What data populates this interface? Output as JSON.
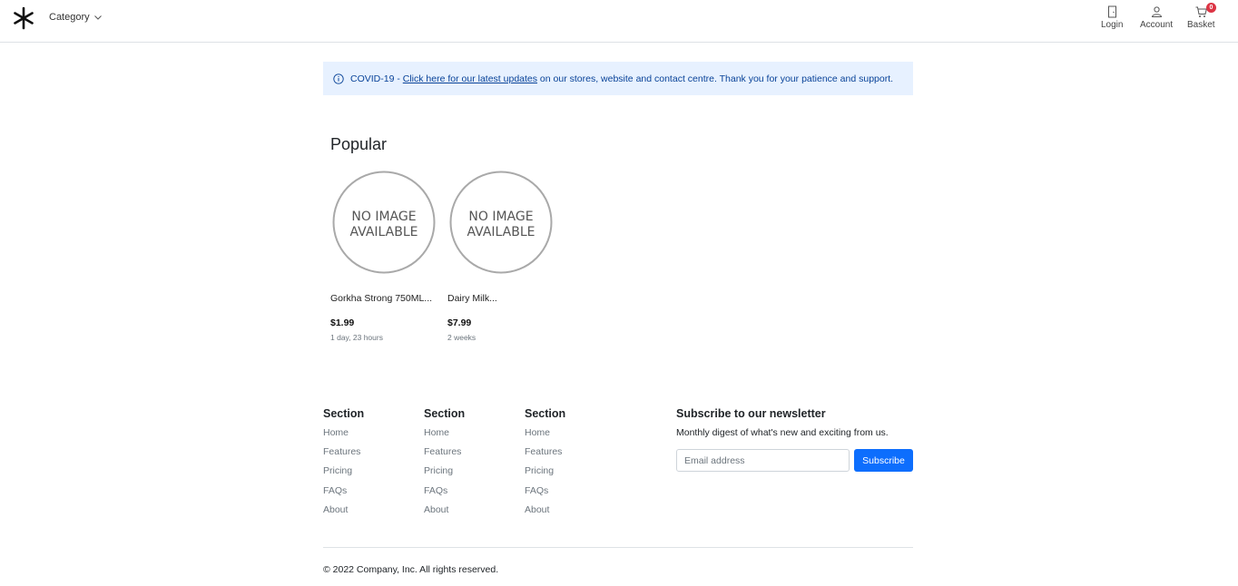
{
  "header": {
    "category_label": "Category",
    "nav": {
      "login_label": "Login",
      "account_label": "Account",
      "basket_label": "Basket",
      "basket_count": "0"
    }
  },
  "alert": {
    "prefix": "COVID-19 - ",
    "link_text": "Click here for our latest updates",
    "suffix": " on our stores, website and contact centre. Thank you for your patience and support."
  },
  "popular": {
    "title": "Popular",
    "products": [
      {
        "image_text_1": "NO IMAGE",
        "image_text_2": "AVAILABLE",
        "name": "Gorkha Strong 750ML...",
        "price": "$1.99",
        "time": "1 day, 23 hours"
      },
      {
        "image_text_1": "NO IMAGE",
        "image_text_2": "AVAILABLE",
        "name": "Dairy Milk...",
        "price": "$7.99",
        "time": "2 weeks"
      }
    ]
  },
  "footer": {
    "columns": [
      {
        "heading": "Section",
        "links": [
          "Home",
          "Features",
          "Pricing",
          "FAQs",
          "About"
        ]
      },
      {
        "heading": "Section",
        "links": [
          "Home",
          "Features",
          "Pricing",
          "FAQs",
          "About"
        ]
      },
      {
        "heading": "Section",
        "links": [
          "Home",
          "Features",
          "Pricing",
          "FAQs",
          "About"
        ]
      }
    ],
    "newsletter": {
      "title": "Subscribe to our newsletter",
      "description": "Monthly digest of what's new and exciting from us.",
      "email_placeholder": "Email address",
      "subscribe_label": "Subscribe"
    },
    "copyright": "© 2022 Company, Inc. All rights reserved."
  },
  "colors": {
    "alert_bg": "#e7f1ff",
    "alert_text": "#084298",
    "primary": "#0d6efd",
    "badge": "#dc3545"
  }
}
